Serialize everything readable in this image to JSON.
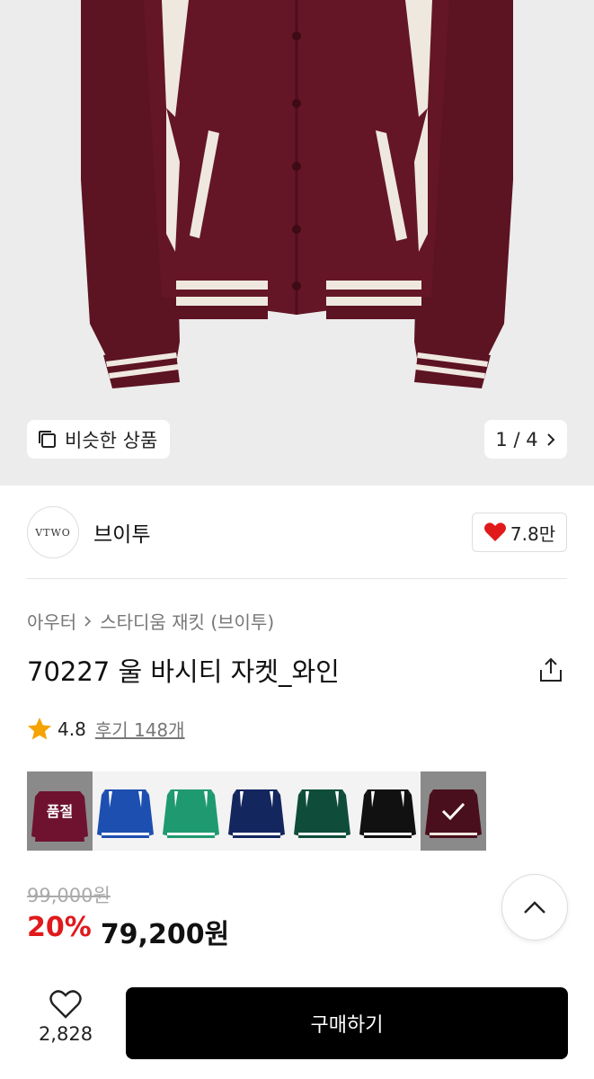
{
  "hero": {
    "similar_label": "비슷한 상품",
    "pager": "1 / 4"
  },
  "brand": {
    "logo_text": "VTWO",
    "name": "브이투",
    "likes": "7.8만"
  },
  "breadcrumb": {
    "category": "아우터",
    "subcategory": "스타디움 재킷 (브이투)"
  },
  "product": {
    "title": "70227 울 바시티 자켓_와인",
    "rating": "4.8",
    "reviews": "후기 148개"
  },
  "swatches": [
    {
      "color": "#6e1230",
      "sleeve": "#6e1230",
      "label": "품절"
    },
    {
      "color": "#1d4fb0",
      "sleeve": "#1d4fb0",
      "label": ""
    },
    {
      "color": "#1f9a70",
      "sleeve": "#1f9a70",
      "label": ""
    },
    {
      "color": "#13265e",
      "sleeve": "#13265e",
      "label": ""
    },
    {
      "color": "#0f4d3a",
      "sleeve": "#0f4d3a",
      "label": ""
    },
    {
      "color": "#111111",
      "sleeve": "#111111",
      "label": ""
    },
    {
      "color": "#4a0f1c",
      "sleeve": "#4a0f1c",
      "label": ""
    }
  ],
  "price": {
    "original": "99,000원",
    "discount": "20%",
    "sale": "79,200원"
  },
  "bottom_bar": {
    "like_count": "2,828",
    "buy_label": "구매하기"
  },
  "colors": {
    "accent": "#e0191b",
    "jacket": "#5c1322",
    "heart": "#e0191b",
    "star": "#f5a300"
  }
}
